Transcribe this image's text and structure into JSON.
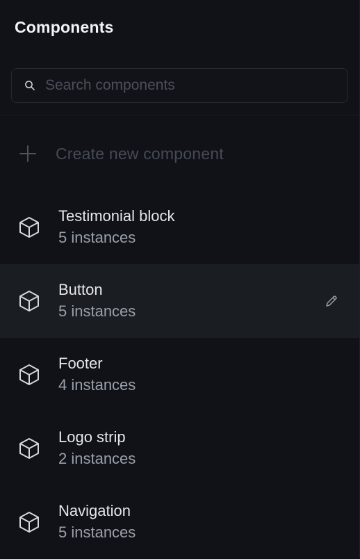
{
  "panel": {
    "title": "Components"
  },
  "search": {
    "placeholder": "Search components",
    "value": "",
    "icon": "search-icon"
  },
  "create": {
    "label": "Create new component",
    "icon": "plus-icon"
  },
  "components": [
    {
      "name": "Testimonial block",
      "count": "5 instances",
      "icon": "cube-icon",
      "selected": false
    },
    {
      "name": "Button",
      "count": "5 instances",
      "icon": "cube-icon",
      "selected": true,
      "action_icon": "pencil-icon"
    },
    {
      "name": "Footer",
      "count": "4 instances",
      "icon": "cube-icon",
      "selected": false
    },
    {
      "name": "Logo strip",
      "count": "2 instances",
      "icon": "cube-icon",
      "selected": false
    },
    {
      "name": "Navigation",
      "count": "5 instances",
      "icon": "cube-icon",
      "selected": false
    }
  ],
  "colors": {
    "background": "#101217",
    "selected_row": "#1a1d22",
    "text_primary": "#e4e6ea",
    "text_secondary": "#9aa0aa",
    "text_muted": "#454a54"
  }
}
